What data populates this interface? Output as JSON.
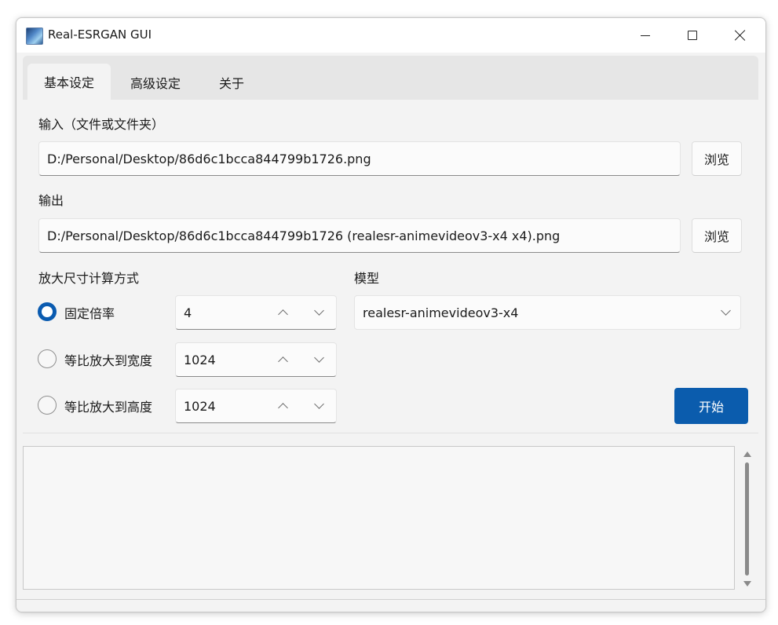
{
  "window": {
    "title": "Real-ESRGAN GUI",
    "icons": {
      "app": "app-logo-icon",
      "minimize": "minimize-icon",
      "maximize": "maximize-icon",
      "close": "close-icon"
    }
  },
  "tabs": [
    {
      "label": "基本设定",
      "active": true
    },
    {
      "label": "高级设定",
      "active": false
    },
    {
      "label": "关于",
      "active": false
    }
  ],
  "input": {
    "label": "输入（文件或文件夹）",
    "value": "D:/Personal/Desktop/86d6c1bcca844799b1726.png",
    "browse_label": "浏览"
  },
  "output": {
    "label": "输出",
    "value": "D:/Personal/Desktop/86d6c1bcca844799b1726 (realesr-animevideov3-x4 x4).png",
    "browse_label": "浏览"
  },
  "scale": {
    "label": "放大尺寸计算方式",
    "options": [
      {
        "label": "固定倍率",
        "value": "4",
        "checked": true
      },
      {
        "label": "等比放大到宽度",
        "value": "1024",
        "checked": false
      },
      {
        "label": "等比放大到高度",
        "value": "1024",
        "checked": false
      }
    ]
  },
  "model": {
    "label": "模型",
    "selected": "realesr-animevideov3-x4"
  },
  "start_label": "开始",
  "log": {
    "content": ""
  },
  "colors": {
    "accent": "#0b5cad",
    "radio_checked": "#0a5bb0",
    "background": "#f3f3f3"
  }
}
